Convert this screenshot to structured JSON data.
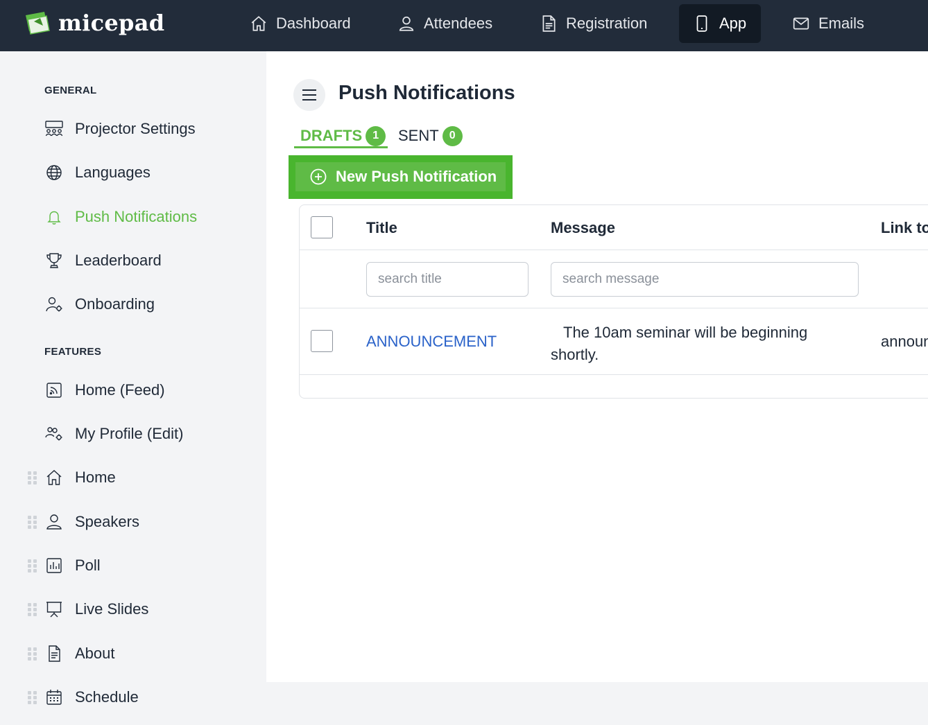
{
  "app": {
    "name": "micepad"
  },
  "topnav": {
    "items": [
      {
        "label": "Dashboard",
        "icon": "home-icon"
      },
      {
        "label": "Attendees",
        "icon": "user-icon"
      },
      {
        "label": "Registration",
        "icon": "document-icon"
      },
      {
        "label": "App",
        "icon": "phone-icon",
        "active": true
      },
      {
        "label": "Emails",
        "icon": "mail-icon"
      }
    ]
  },
  "sidebar": {
    "general_heading": "GENERAL",
    "features_heading": "FEATURES",
    "items": [
      {
        "label": "Projector Settings",
        "icon": "people-group-icon"
      },
      {
        "label": "Languages",
        "icon": "globe-icon"
      },
      {
        "label": "Push Notifications",
        "icon": "bell-icon",
        "active": true
      },
      {
        "label": "Leaderboard",
        "icon": "trophy-icon"
      },
      {
        "label": "Onboarding",
        "icon": "user-gear-icon"
      },
      {
        "label": "Home (Feed)",
        "icon": "rss-icon"
      },
      {
        "label": "My Profile (Edit)",
        "icon": "users-gear-icon"
      },
      {
        "label": "Home",
        "icon": "home-icon"
      },
      {
        "label": "Speakers",
        "icon": "user-icon"
      },
      {
        "label": "Poll",
        "icon": "bar-chart-icon"
      },
      {
        "label": "Live Slides",
        "icon": "presentation-icon"
      },
      {
        "label": "About",
        "icon": "document-icon"
      },
      {
        "label": "Schedule",
        "icon": "calendar-icon"
      }
    ]
  },
  "main": {
    "title": "Push Notifications",
    "tabs": [
      {
        "label": "DRAFTS",
        "count": "1",
        "active": true
      },
      {
        "label": "SENT",
        "count": "0"
      }
    ],
    "new_button_label": "New Push Notification",
    "table": {
      "columns": [
        "Title",
        "Message",
        "Link to"
      ],
      "search_title_placeholder": "search title",
      "search_message_placeholder": "search message",
      "rows": [
        {
          "title": "ANNOUNCEMENT",
          "message": "The 10am seminar will be beginning shortly.",
          "link": "announ"
        }
      ]
    }
  },
  "colors": {
    "brand_green": "#5fbb46",
    "nav_bg": "#222c3a",
    "link_blue": "#2a62c9"
  }
}
